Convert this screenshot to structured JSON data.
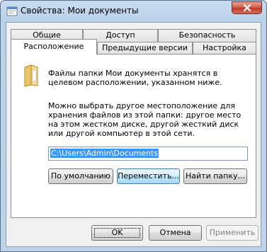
{
  "window": {
    "title": "Свойства: Мои документы"
  },
  "tabs": {
    "row1": [
      "Общие",
      "Доступ",
      "Безопасность"
    ],
    "row2": [
      "Расположение",
      "Предыдущие версии",
      "Настройка"
    ],
    "active": "Расположение"
  },
  "panel": {
    "info": "Файлы папки Мои документы хранятся в целевом расположении, указанном ниже.",
    "description": "Можно выбрать другое местоположение для хранения файлов из этой папки: другое место на этом жестком диске, другой жесткий диск или другой компьютер в этой сети.",
    "path_value": "C:\\Users\\Admin\\Documents",
    "btn_default": "По умолчанию",
    "btn_move": "Переместить...",
    "btn_find": "Найти папку..."
  },
  "footer": {
    "ok": "OK",
    "cancel": "Отмена",
    "apply": "Применить"
  }
}
